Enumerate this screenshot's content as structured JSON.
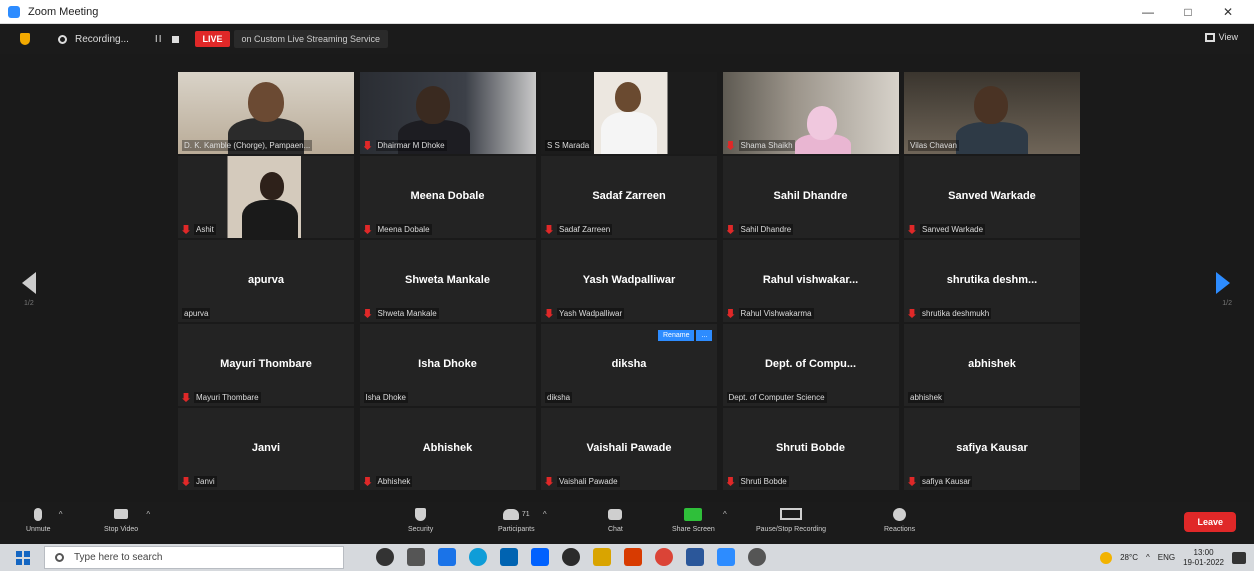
{
  "window": {
    "title": "Zoom Meeting",
    "controls": [
      "—",
      "□",
      "✕"
    ]
  },
  "topbar": {
    "recording_label": "Recording...",
    "pause_label": "II",
    "live_badge": "LIVE",
    "live_target": "on Custom Live Streaming Service",
    "view_label": "View"
  },
  "nav": {
    "page_left": "1/2",
    "page_right": "1/2"
  },
  "participants": [
    {
      "name": "",
      "label": "D. K. Kamble (Chorge), Pampaen...",
      "video": true,
      "muted": false,
      "scene": "man1"
    },
    {
      "name": "",
      "label": "Dhairmar M Dhoke",
      "video": true,
      "muted": true,
      "scene": "man2"
    },
    {
      "name": "",
      "label": "S S Marada",
      "video": true,
      "muted": false,
      "active": true,
      "scene": "man3"
    },
    {
      "name": "",
      "label": "Shama Shaikh",
      "video": true,
      "muted": true,
      "scene": "woman1"
    },
    {
      "name": "",
      "label": "Vilas Chavan",
      "video": true,
      "muted": false,
      "scene": "man4"
    },
    {
      "name": "",
      "label": "Ashit",
      "video": true,
      "muted": true,
      "scene": "man5"
    },
    {
      "name": "Meena Dobale",
      "label": "Meena Dobale",
      "muted": true
    },
    {
      "name": "Sadaf Zarreen",
      "label": "Sadaf Zarreen",
      "muted": true
    },
    {
      "name": "Sahil Dhandre",
      "label": "Sahil Dhandre",
      "muted": true
    },
    {
      "name": "Sanved Warkade",
      "label": "Sanved Warkade",
      "muted": true
    },
    {
      "name": "apurva",
      "label": "apurva",
      "muted": false
    },
    {
      "name": "Shweta Mankale",
      "label": "Shweta Mankale",
      "muted": true
    },
    {
      "name": "Yash Wadpalliwar",
      "label": "Yash Wadpalliwar",
      "muted": true
    },
    {
      "name": "Rahul  vishwakar...",
      "label": "Rahul Vishwakarma",
      "muted": true
    },
    {
      "name": "shrutika  deshm...",
      "label": "shrutika deshmukh",
      "muted": true
    },
    {
      "name": "Mayuri Thombare",
      "label": "Mayuri Thombare",
      "muted": true
    },
    {
      "name": "Isha Dhoke",
      "label": "Isha Dhoke",
      "muted": false
    },
    {
      "name": "diksha",
      "label": "diksha",
      "muted": false
    },
    {
      "name": "Dept. of Compu...",
      "label": "Dept. of Computer Science",
      "muted": false
    },
    {
      "name": "abhishek",
      "label": "abhishek",
      "muted": false
    },
    {
      "name": "Janvi",
      "label": "Janvi",
      "muted": true
    },
    {
      "name": "Abhishek",
      "label": "Abhishek",
      "muted": true
    },
    {
      "name": "Vaishali Pawade",
      "label": "Vaishali Pawade",
      "muted": true
    },
    {
      "name": "Shruti Bobde",
      "label": "Shruti Bobde",
      "muted": true
    },
    {
      "name": "safiya Kausar",
      "label": "safiya Kausar",
      "muted": true
    }
  ],
  "float_buttons": [
    "Rename",
    "..."
  ],
  "toolbar": {
    "unmute": "Unmute",
    "start_video": "Stop Video",
    "security": "Security",
    "participants": "Participants",
    "participants_count": "71",
    "chat": "Chat",
    "share": "Share Screen",
    "live_recording": "Pause/Stop Recording",
    "reactions": "Reactions",
    "leave": "Leave"
  },
  "taskbar": {
    "search_placeholder": "Type here to search",
    "weather": "28°C",
    "lang": "ENG",
    "time": "13:00",
    "date": "19-01-2022"
  },
  "colors": {
    "zoom_blue": "#2d8cff",
    "leave_red": "#e02828",
    "share_green": "#2fbf3a",
    "active_speaker": "#d7e05a"
  }
}
